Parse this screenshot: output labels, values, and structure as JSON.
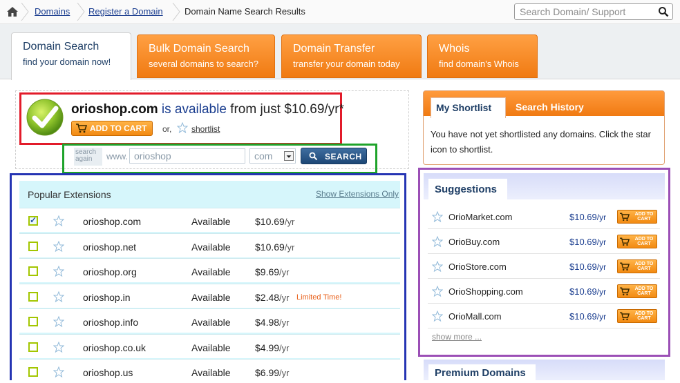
{
  "breadcrumb": {
    "items": [
      "Domains",
      "Register a Domain"
    ],
    "current": "Domain Name Search Results"
  },
  "header_search": {
    "placeholder": "Search Domain/ Support"
  },
  "tabs": [
    {
      "title": "Domain Search",
      "subtitle": "find your domain now!"
    },
    {
      "title": "Bulk Domain Search",
      "subtitle": "several domains to search?"
    },
    {
      "title": "Domain Transfer",
      "subtitle": "transfer your domain today"
    },
    {
      "title": "Whois",
      "subtitle": "find domain's Whois"
    }
  ],
  "result": {
    "domain": "orioshop.com",
    "is_available": "is available",
    "from": " from just ",
    "price": "$10.69/yr*",
    "add_to_cart": "ADD TO CART",
    "or": "or,",
    "shortlist": "shortlist"
  },
  "search_again": {
    "label": "search again",
    "www": "www.",
    "value": "orioshop",
    "tld": "com",
    "button": "SEARCH"
  },
  "popular": {
    "title": "Popular Extensions",
    "show_only": "Show Extensions Only",
    "rows": [
      {
        "name": "orioshop.com",
        "status": "Available",
        "price": "$10.69",
        "per": "/yr",
        "tag": "",
        "checked": true
      },
      {
        "name": "orioshop.net",
        "status": "Available",
        "price": "$10.69",
        "per": "/yr",
        "tag": "",
        "checked": false
      },
      {
        "name": "orioshop.org",
        "status": "Available",
        "price": "$9.69",
        "per": "/yr",
        "tag": "",
        "checked": false
      },
      {
        "name": "orioshop.in",
        "status": "Available",
        "price": "$2.48",
        "per": "/yr",
        "tag": "Limited Time!",
        "checked": false
      },
      {
        "name": "orioshop.info",
        "status": "Available",
        "price": "$4.98",
        "per": "/yr",
        "tag": "",
        "checked": false
      },
      {
        "name": "orioshop.co.uk",
        "status": "Available",
        "price": "$4.99",
        "per": "/yr",
        "tag": "",
        "checked": false
      },
      {
        "name": "orioshop.us",
        "status": "Available",
        "price": "$6.99",
        "per": "/yr",
        "tag": "",
        "checked": false
      }
    ]
  },
  "shortlist_panel": {
    "tab_active": "My Shortlist",
    "tab_other": "Search History",
    "text": "You have not yet shortlisted any domains. Click the star icon to shortlist."
  },
  "suggestions": {
    "title": "Suggestions",
    "cart_label_1": "ADD TO",
    "cart_label_2": "CART",
    "items": [
      {
        "name": "OrioMarket.com",
        "price": "$10.69",
        "per": "/yr"
      },
      {
        "name": "OrioBuy.com",
        "price": "$10.69",
        "per": "/yr"
      },
      {
        "name": "OrioStore.com",
        "price": "$10.69",
        "per": "/yr"
      },
      {
        "name": "OrioShopping.com",
        "price": "$10.69",
        "per": "/yr"
      },
      {
        "name": "OrioMall.com",
        "price": "$10.69",
        "per": "/yr"
      }
    ],
    "show_more": "show more ..."
  },
  "premium": {
    "title": "Premium Domains"
  },
  "colors": {
    "orange_tab": "#f28a1c",
    "link_blue": "#1a3d8f",
    "highlight_red": "#e21b2a",
    "highlight_green": "#1ea32a",
    "highlight_blue": "#2534b3",
    "highlight_purple": "#9b4fb6"
  }
}
